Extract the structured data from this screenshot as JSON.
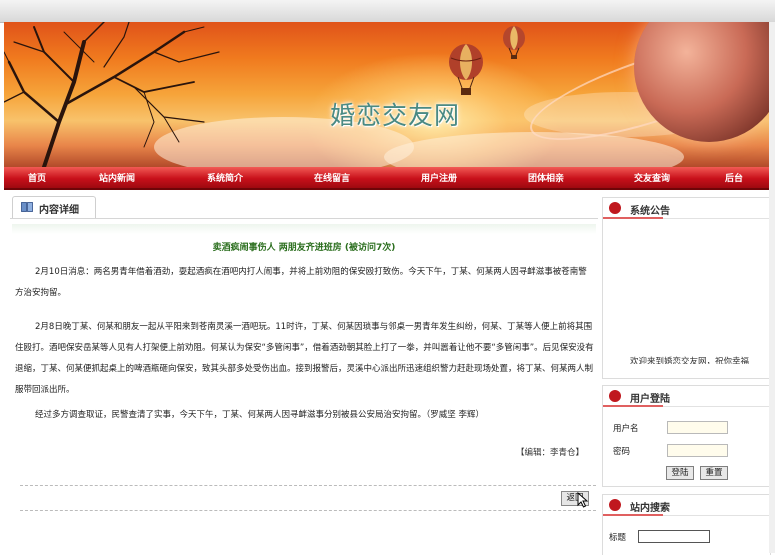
{
  "site": {
    "title": "婚恋交友网"
  },
  "nav": {
    "items": [
      "首页",
      "站内新闻",
      "系统简介",
      "在线留言",
      "用户注册",
      "团体相亲",
      "交友查询",
      "后台"
    ]
  },
  "content": {
    "tab_label": "内容详细",
    "article_title": "卖酒疯闹事伤人  两朋友齐进班房  (被访问7次)",
    "paragraphs": [
      "2月10日消息：两名男青年借着酒劲，耍起酒疯在酒吧内打人闹事，并将上前劝阻的保安殴打致伤。今天下午，丁某、何某两人因寻衅滋事被苍南警方治安拘留。",
      "2月8日晚丁某、何某和朋友一起从平阳来到苍南灵溪一酒吧玩。11时许，丁某、何某因琐事与邻桌一男青年发生纠纷，何某、丁某等人便上前将其围住殴打。酒吧保安岳某等人见有人打架便上前劝阻。何某认为保安“多管闲事”，借着酒劲朝其脸上打了一拳，并叫嚣着让他不要“多管闲事”。后见保安没有退缩，丁某、何某便抓起桌上的啤酒瓶砸向保安，致其头部多处受伤出血。接到报警后，灵溪中心派出所迅速组织警力赶赴现场处置，将丁某、何某两人制服带回派出所。",
      "经过多方调查取证，民警查清了实事，今天下午，丁某、何某两人因寻衅滋事分别被县公安局治安拘留。（罗威坚 李辉）"
    ],
    "editor": "【编辑：李青仓】",
    "back_label": "返回"
  },
  "sidebar": {
    "notice": {
      "title": "系统公告",
      "marquee": "欢迎来到婚恋交友网，祝你幸福"
    },
    "login": {
      "title": "用户登陆",
      "username_label": "用户名",
      "password_label": "密码",
      "login_button": "登陆",
      "reset_button": "重置"
    },
    "search": {
      "title": "站内搜索",
      "title_label": "标题"
    }
  },
  "colors": {
    "nav_red": "#c8101a",
    "title_green": "#2b6e1e",
    "accent": "#e06060"
  }
}
